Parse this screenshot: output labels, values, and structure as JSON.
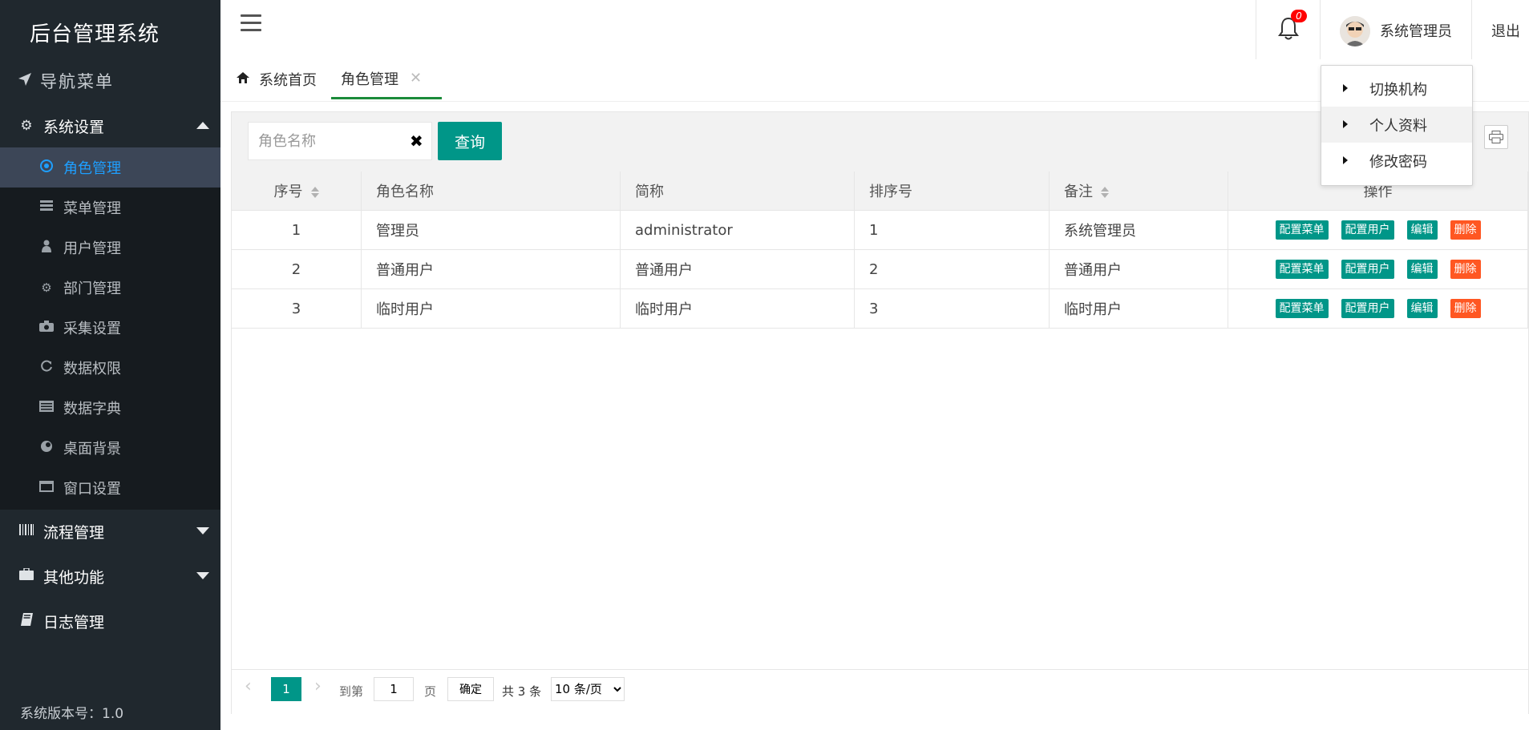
{
  "sidebar": {
    "brand": "后台管理系统",
    "nav_title": "导航菜单",
    "system_settings": "系统设置",
    "items": [
      {
        "label": "角色管理",
        "icon": "radio-icon"
      },
      {
        "label": "菜单管理",
        "icon": "list-icon"
      },
      {
        "label": "用户管理",
        "icon": "user-icon"
      },
      {
        "label": "部门管理",
        "icon": "cogs-icon"
      },
      {
        "label": "采集设置",
        "icon": "camera-icon"
      },
      {
        "label": "数据权限",
        "icon": "refresh-icon"
      },
      {
        "label": "数据字典",
        "icon": "dictionary-icon"
      },
      {
        "label": "桌面背景",
        "icon": "palette-icon"
      },
      {
        "label": "窗口设置",
        "icon": "window-icon"
      }
    ],
    "workflow": "流程管理",
    "other": "其他功能",
    "log": "日志管理",
    "version": "系统版本号：1.0"
  },
  "header": {
    "notification_count": "0",
    "user_name": "系统管理员",
    "logout": "退出"
  },
  "tabs": {
    "home": "系统首页",
    "active": "角色管理"
  },
  "search": {
    "placeholder": "角色名称",
    "query_label": "查询"
  },
  "table": {
    "headers": [
      "序号",
      "角色名称",
      "简称",
      "排序号",
      "备注",
      "操作"
    ],
    "rows": [
      {
        "no": "1",
        "name": "管理员",
        "short": "administrator",
        "order": "1",
        "remark": "系统管理员"
      },
      {
        "no": "2",
        "name": "普通用户",
        "short": "普通用户",
        "order": "2",
        "remark": "普通用户"
      },
      {
        "no": "3",
        "name": "临时用户",
        "short": "临时用户",
        "order": "3",
        "remark": "临时用户"
      }
    ],
    "actions": {
      "menu": "配置菜单",
      "user": "配置用户",
      "edit": "编辑",
      "delete": "删除"
    }
  },
  "pager": {
    "current": "1",
    "goto_label": "到第",
    "goto_value": "1",
    "page_label": "页",
    "confirm": "确定",
    "total": "共 3 条",
    "page_size": "10 条/页"
  },
  "dropdown": {
    "items": [
      "切换机构",
      "个人资料",
      "修改密码"
    ]
  },
  "colors": {
    "sidebar_bg": "#20282e",
    "active_item": "#1e9fff",
    "primary": "#009688",
    "danger": "#ff5722",
    "tab_underline": "#1b8b3a"
  }
}
